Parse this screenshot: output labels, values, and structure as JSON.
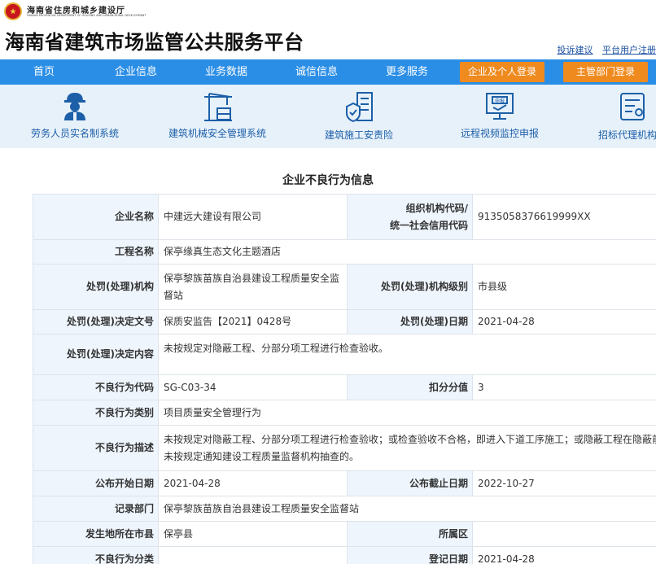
{
  "header": {
    "org_cn": "海南省住房和城乡建设厅",
    "org_en": "HAINAN PROVINCIAL DEPARTMENT OF HOUSING AND URBAN-RURAL DEVELOPMENT",
    "site_title": "海南省建筑市场监管公共服务平台",
    "links": [
      "投诉建议",
      "平台用户注册"
    ]
  },
  "nav": {
    "items": [
      "首页",
      "企业信息",
      "业务数据",
      "诚信信息",
      "更多服务"
    ],
    "login_company": "企业及个人登录",
    "login_admin": "主管部门登录"
  },
  "systems": [
    {
      "label": "劳务人员实名制系统",
      "icon": "worker-icon"
    },
    {
      "label": "建筑机械安全管理系统",
      "icon": "crane-icon"
    },
    {
      "label": "建筑施工安责险",
      "icon": "insurance-building-icon"
    },
    {
      "label": "远程视频监控申报",
      "icon": "monitor-report-icon"
    },
    {
      "label": "招标代理机构信",
      "icon": "document-icon"
    }
  ],
  "page_title": "企业不良行为信息",
  "record": {
    "company_name_label": "企业名称",
    "company_name": "中建远大建设有限公司",
    "org_code_label_1": "组织机构代码/",
    "org_code_label_2": "统一社会信用代码",
    "org_code": "9135058376619999XX",
    "project_label": "工程名称",
    "project": "保亭缘真生态文化主题酒店",
    "punish_org_label": "处罚(处理)机构",
    "punish_org": "保亭黎族苗族自治县建设工程质量安全监督站",
    "punish_level_label": "处罚(处理)机构级别",
    "punish_level": "市县级",
    "decision_no_label": "处罚(处理)决定文号",
    "decision_no": "保质安监告【2021】0428号",
    "punish_date_label": "处罚(处理)日期",
    "punish_date": "2021-04-28",
    "decision_content_label": "处罚(处理)决定内容",
    "decision_content": "未按规定对隐蔽工程、分部分项工程进行检查验收。",
    "bad_code_label": "不良行为代码",
    "bad_code": "SG-C03-34",
    "score_label": "扣分分值",
    "score": "3",
    "bad_type_label": "不良行为类别",
    "bad_type": "项目质量安全管理行为",
    "bad_desc_label": "不良行为描述",
    "bad_desc": "未按规定对隐蔽工程、分部分项工程进行检查验收；或检查验收不合格，即进入下道工序施工；或隐蔽工程在隐蔽前未按规定通知建设工程质量监督机构抽查的。",
    "publish_start_label": "公布开始日期",
    "publish_start": "2021-04-28",
    "publish_end_label": "公布截止日期",
    "publish_end": "2022-10-27",
    "record_dept_label": "记录部门",
    "record_dept": "保亭黎族苗族自治县建设工程质量安全监督站",
    "location_label": "发生地所在市县",
    "location": "保亭县",
    "district_label": "所属区",
    "district": "",
    "bad_class_label": "不良行为分类",
    "bad_class": "",
    "register_date_label": "登记日期",
    "register_date": "2021-04-28"
  },
  "colors": {
    "nav_bg": "#2b8ee6",
    "login_btn": "#ef8a1e",
    "band_bg": "#e7f1fa",
    "label_bg": "#eef5fd",
    "link": "#1a4fa0"
  }
}
